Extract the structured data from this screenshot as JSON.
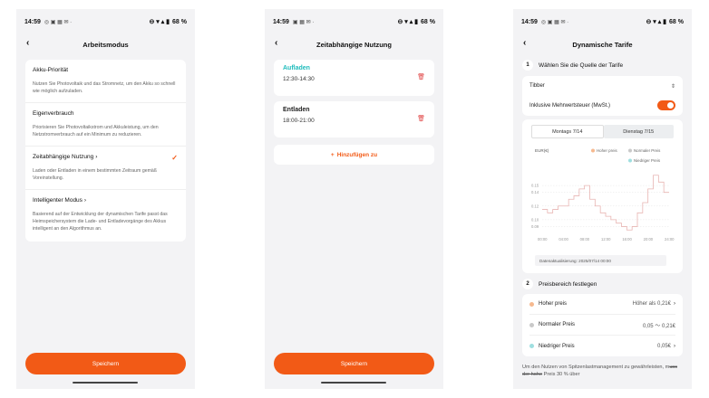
{
  "colors": {
    "accent": "#f25a16",
    "cyan": "#1fbcbc",
    "high": "#f6b98f",
    "normal": "#c9c9c9",
    "low": "#9fdfe0",
    "line": "#e8b5b2"
  },
  "status": {
    "time": "14:59",
    "battery": "68 %"
  },
  "screen1": {
    "title": "Arbeitsmodus",
    "modes": [
      {
        "title": "Akku-Priorität",
        "desc": "Nutzen Sie Photovoltaik und das Stromnetz, um den Akku so schnell wie möglich aufzuladen."
      },
      {
        "title": "Eigenverbrauch",
        "desc": "Priorisieren Sie Photovoltaikstrom und Akkuleistung, um den Netzstromverbrauch auf ein Minimum zu reduzieren."
      },
      {
        "title": "Zeitabhängige Nutzung",
        "desc": "Laden oder Entladen in einem bestimmten Zeitraum gemäß Voreinstellung."
      },
      {
        "title": "Intelligenter Modus",
        "desc": "Basierend auf der Entwicklung der dynamischen Tarife passt das Heimspeichersystem die Lade- und Entladevorgänge des Akkus intelligent an den Algorithmus an."
      }
    ],
    "save": "Speichern"
  },
  "screen2": {
    "title": "Zeitabhängige Nutzung",
    "schedules": [
      {
        "title": "Aufladen",
        "time": "12:30-14:30"
      },
      {
        "title": "Entladen",
        "time": "18:00-21:00"
      }
    ],
    "add": "Hinzufügen zu",
    "save": "Speichern"
  },
  "screen3": {
    "title": "Dynamische Tarife",
    "section1_num": "1",
    "section1": "Wählen Sie die Quelle der Tarife",
    "provider": "Tibber",
    "vat": "Inklusive Mehrwertsteuer (MwSt.)",
    "tabs": [
      "Montags 7/14",
      "Dienstag 7/15"
    ],
    "updated": "Datenaktualisierung: 2025/07/14 00:00",
    "section2_num": "2",
    "section2": "Preisbereich festlegen",
    "prices": [
      {
        "name": "Hoher preis",
        "value": "Höher als 0,21€"
      },
      {
        "name": "Normaler Preis",
        "value": "0,05 〜 0,21€"
      },
      {
        "name": "Niedriger Preis",
        "value": "0,05€"
      }
    ],
    "footer_a": "Um den Nutzen von Spitzenlastmanagement zu gewährleisten, m",
    "footer_strike": "uss der hohe",
    "footer_b": " Preis 30 % über"
  },
  "chart_data": {
    "type": "line",
    "ylabel": "EUR(€)",
    "legend": [
      "Hoher preis",
      "Normaler Preis",
      "Niedriger Preis"
    ],
    "yticks": [
      "0.15",
      "0.14",
      "0.12",
      "0.10",
      "0.09"
    ],
    "xticks": [
      "00:00",
      "04:00",
      "08:00",
      "12:00",
      "16:00",
      "20:00",
      "24:00"
    ],
    "x": [
      0,
      1,
      2,
      3,
      4,
      5,
      6,
      7,
      8,
      9,
      10,
      11,
      12,
      13,
      14,
      15,
      16,
      17,
      18,
      19,
      20,
      21,
      22,
      23,
      24
    ],
    "values": [
      0.115,
      0.11,
      0.115,
      0.12,
      0.12,
      0.13,
      0.135,
      0.145,
      0.15,
      0.13,
      0.12,
      0.11,
      0.105,
      0.1,
      0.095,
      0.09,
      0.085,
      0.09,
      0.11,
      0.125,
      0.145,
      0.165,
      0.155,
      0.14,
      0.14
    ],
    "ylim": [
      0.08,
      0.17
    ],
    "legend_position": "top-right"
  }
}
